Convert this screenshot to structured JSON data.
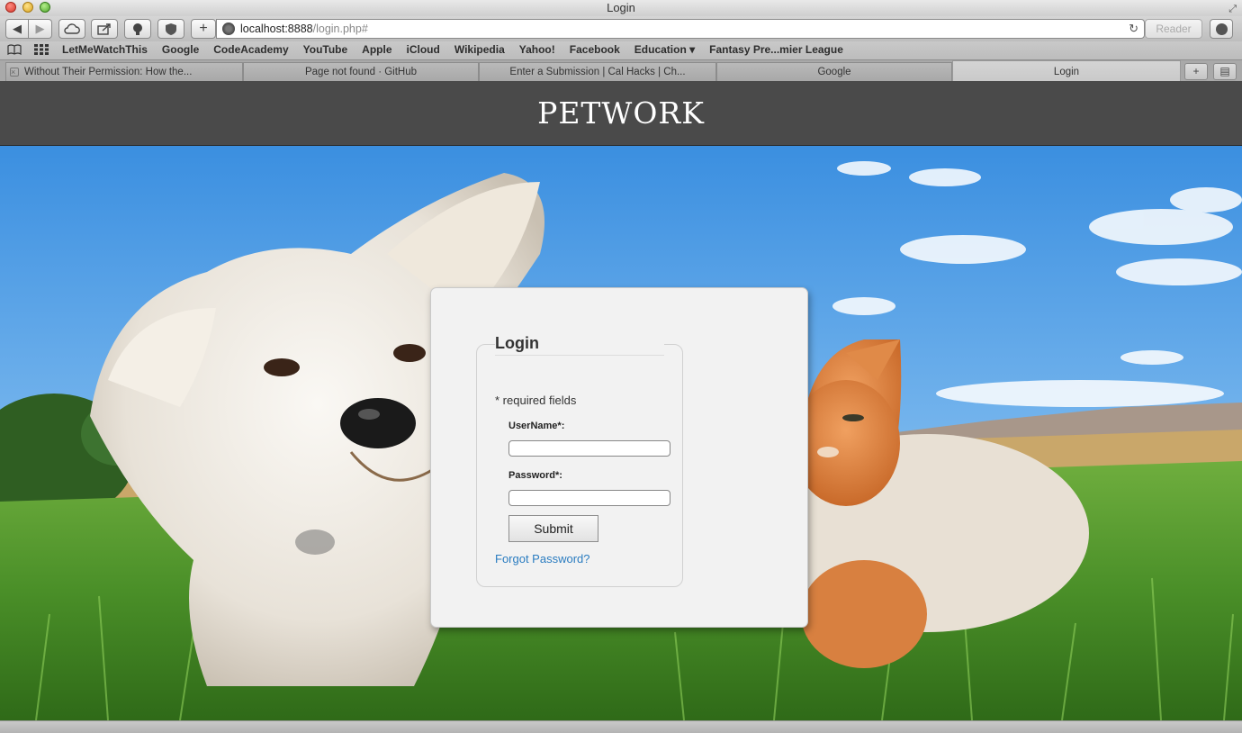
{
  "window": {
    "title": "Login"
  },
  "toolbar": {
    "back_glyph": "◀",
    "forward_glyph": "▶",
    "new_tab_glyph": "+",
    "url_host": "localhost:8888",
    "url_path": "/login.php#",
    "reload_glyph": "↻",
    "reader_label": "Reader"
  },
  "bookmarks": {
    "items": [
      "LetMeWatchThis",
      "Google",
      "CodeAcademy",
      "YouTube",
      "Apple",
      "iCloud",
      "Wikipedia",
      "Yahoo!",
      "Facebook",
      "Education ▾",
      "Fantasy Pre...mier League"
    ]
  },
  "tabs": [
    {
      "label": "Without Their Permission: How the..."
    },
    {
      "label": "Page not found · GitHub"
    },
    {
      "label": "Enter a Submission | Cal Hacks | Ch..."
    },
    {
      "label": "Google"
    },
    {
      "label": "Login"
    }
  ],
  "site": {
    "title": "PETWORK"
  },
  "login": {
    "legend": "Login",
    "required_note": "* required fields",
    "username_label": "UserName*:",
    "username_value": "",
    "password_label": "Password*:",
    "password_value": "",
    "submit_label": "Submit",
    "forgot_link": "Forgot Password?"
  },
  "colors": {
    "header_bg": "#4a4a4a",
    "link": "#2a7cc0",
    "card_bg": "#f2f2f2"
  }
}
